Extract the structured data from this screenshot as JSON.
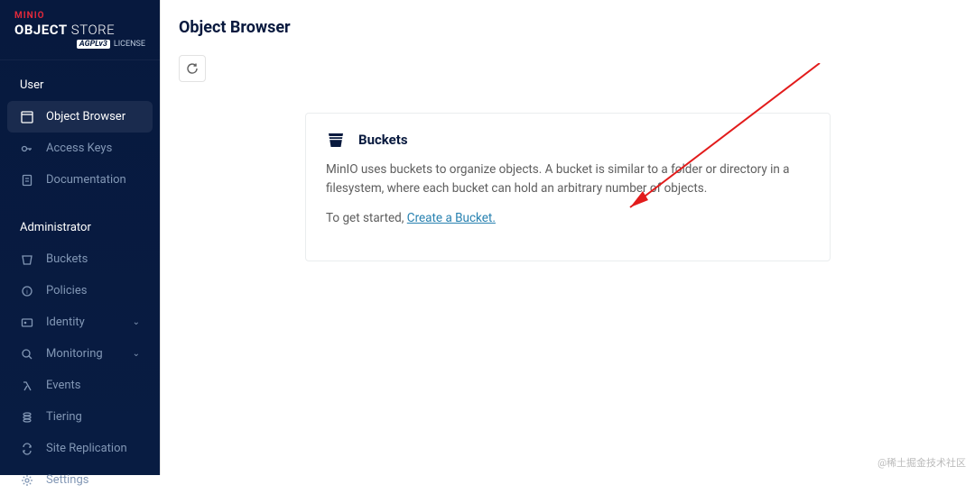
{
  "brand": {
    "top": "MINIO",
    "main_bold": "OBJECT",
    "main_light": "STORE",
    "license_badge": "AGPLv3",
    "license_text": "LICENSE"
  },
  "sidebar": {
    "section_user": "User",
    "section_admin": "Administrator",
    "items_user": [
      {
        "label": "Object Browser",
        "active": true
      },
      {
        "label": "Access Keys"
      },
      {
        "label": "Documentation"
      }
    ],
    "items_admin": [
      {
        "label": "Buckets"
      },
      {
        "label": "Policies"
      },
      {
        "label": "Identity",
        "expandable": true
      },
      {
        "label": "Monitoring",
        "expandable": true
      },
      {
        "label": "Events"
      },
      {
        "label": "Tiering"
      },
      {
        "label": "Site Replication"
      },
      {
        "label": "Settings"
      }
    ]
  },
  "header": {
    "title": "Object Browser"
  },
  "card": {
    "title": "Buckets",
    "desc": "MinIO uses buckets to organize objects. A bucket is similar to a folder or directory in a filesystem, where each bucket can hold an arbitrary number of objects.",
    "cta_prefix": "To get started, ",
    "cta_link": "Create a Bucket."
  },
  "watermark": "@稀土掘金技术社区"
}
